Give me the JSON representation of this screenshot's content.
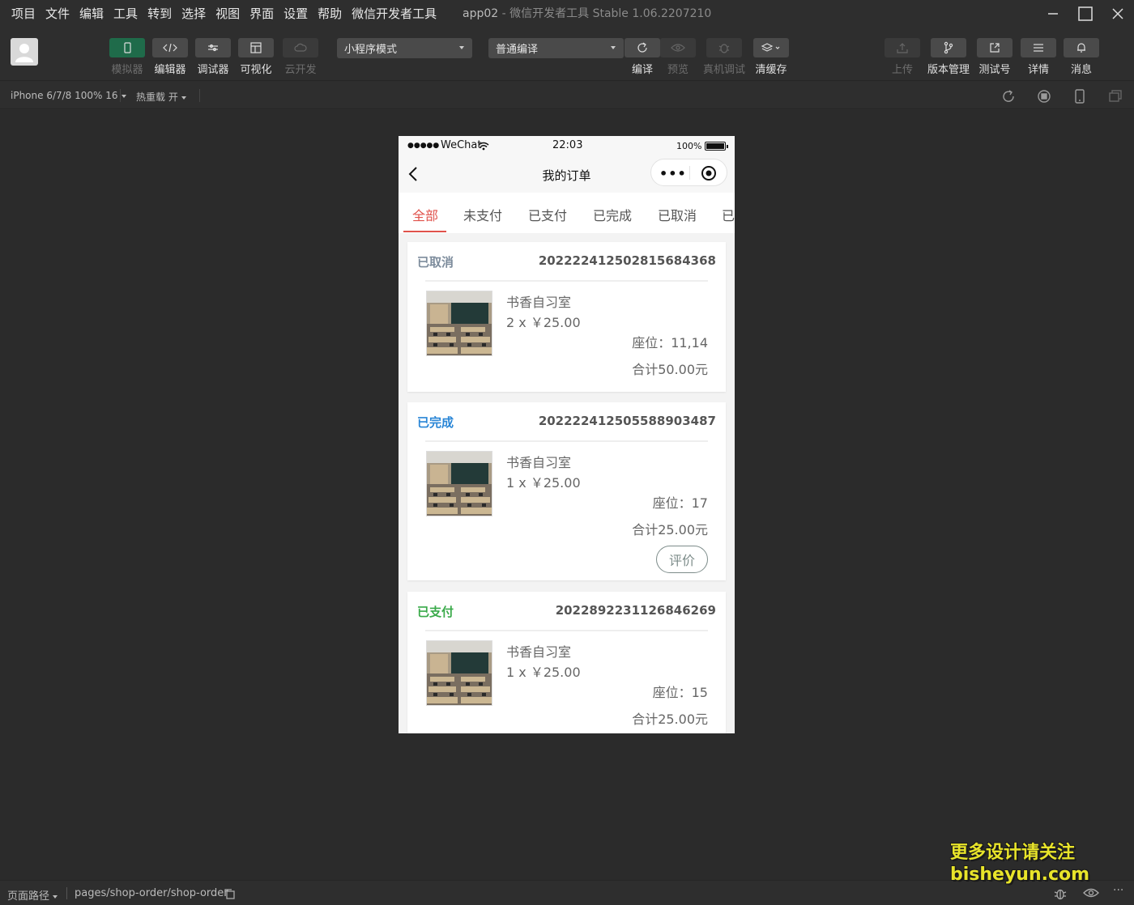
{
  "menu": [
    "项目",
    "文件",
    "编辑",
    "工具",
    "转到",
    "选择",
    "视图",
    "界面",
    "设置",
    "帮助",
    "微信开发者工具"
  ],
  "window": {
    "app": "app02",
    "separator": " - ",
    "product": "微信开发者工具 Stable 1.06.2207210"
  },
  "toolbar": {
    "simulator": "模拟器",
    "editor": "编辑器",
    "debugger": "调试器",
    "visual": "可视化",
    "cloud": "云开发",
    "mode_select": "小程序模式",
    "compile_select": "普通编译",
    "compile": "编译",
    "preview": "预览",
    "real_debug": "真机调试",
    "clear_cache": "清缓存",
    "upload": "上传",
    "version": "版本管理",
    "test_account": "测试号",
    "details": "详情",
    "messages": "消息"
  },
  "subbar": {
    "device": "iPhone 6/7/8 100% 16",
    "hot_reload": "热重载 开"
  },
  "phone": {
    "status": {
      "dots": "●●●●●",
      "carrier": "WeChat",
      "time": "22:03",
      "battery": "100%"
    },
    "nav_title": "我的订单",
    "capsule_more": "•••",
    "tabs": [
      "全部",
      "未支付",
      "已支付",
      "已完成",
      "已取消",
      "已"
    ],
    "orders": [
      {
        "status": "已取消",
        "status_color": "#7d8c9c",
        "order_no": "20222241250281568436​8",
        "product": "书香自习室",
        "qty": "2 x ￥25.00",
        "seat": "座位：11,14",
        "total": "合计50.00元"
      },
      {
        "status": "已完成",
        "status_color": "#2a86d6",
        "order_no": "20222241250558890348​7",
        "product": "书香自习室",
        "qty": "1 x ￥25.00",
        "seat": "座位：17",
        "total": "合计25.00元",
        "review": "评价"
      },
      {
        "status": "已支付",
        "status_color": "#3aaa4a",
        "order_no": "202289223112684626​9",
        "product": "书香自习室",
        "qty": "1 x ￥25.00",
        "seat": "座位：15",
        "total": "合计25.00元"
      }
    ]
  },
  "bottom": {
    "path_label": "页面路径",
    "path": "pages/shop-order/shop-order"
  },
  "watermark": {
    "line1": "更多设计请关注",
    "line2": "bisheyun.com"
  },
  "colors": {
    "accent_tab": "#e0524b",
    "simulator_active": "#1f6b4a"
  }
}
